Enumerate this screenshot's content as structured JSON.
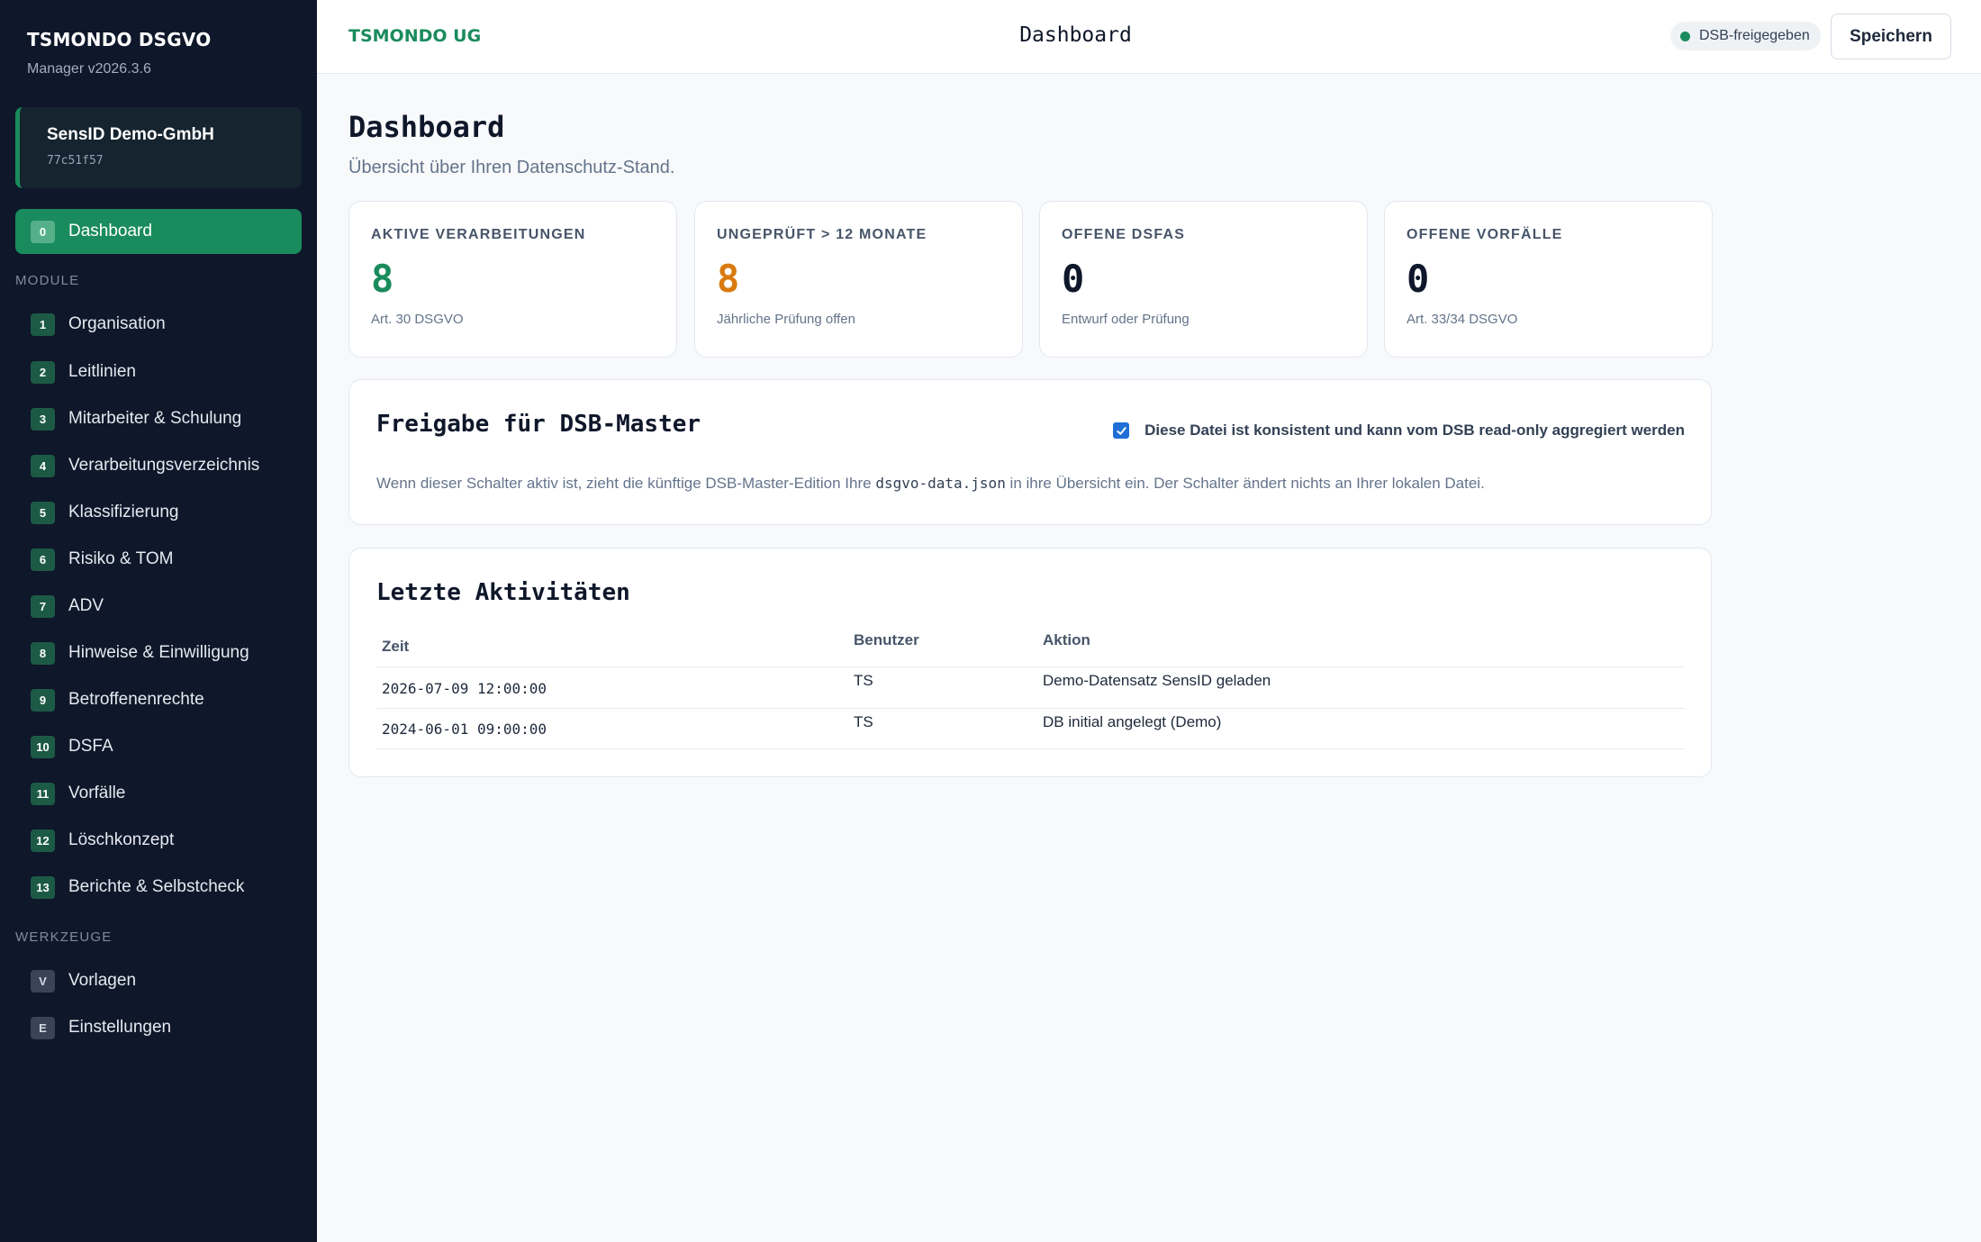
{
  "sidebar": {
    "brand_title": "TSMONDO DSGVO",
    "brand_version": "Manager v2026.3.6",
    "org_name": "SensID Demo-GmbH",
    "org_id": "77c51f57",
    "dashboard": {
      "badge": "0",
      "label": "Dashboard"
    },
    "module_heading": "MODULE",
    "modules": [
      {
        "badge": "1",
        "label": "Organisation"
      },
      {
        "badge": "2",
        "label": "Leitlinien"
      },
      {
        "badge": "3",
        "label": "Mitarbeiter & Schulung"
      },
      {
        "badge": "4",
        "label": "Verarbeitungsverzeichnis"
      },
      {
        "badge": "5",
        "label": "Klassifizierung"
      },
      {
        "badge": "6",
        "label": "Risiko & TOM"
      },
      {
        "badge": "7",
        "label": "ADV"
      },
      {
        "badge": "8",
        "label": "Hinweise & Einwilligung"
      },
      {
        "badge": "9",
        "label": "Betroffenenrechte"
      },
      {
        "badge": "10",
        "label": "DSFA"
      },
      {
        "badge": "11",
        "label": "Vorfälle"
      },
      {
        "badge": "12",
        "label": "Löschkonzept"
      },
      {
        "badge": "13",
        "label": "Berichte & Selbstcheck"
      }
    ],
    "tools_heading": "WERKZEUGE",
    "tools": [
      {
        "badge": "V",
        "label": "Vorlagen"
      },
      {
        "badge": "E",
        "label": "Einstellungen"
      }
    ]
  },
  "topbar": {
    "company": "TSMONDO UG",
    "title": "Dashboard",
    "status": "DSB-freigegeben",
    "save_label": "Speichern"
  },
  "main": {
    "title": "Dashboard",
    "subtitle": "Übersicht über Ihren Datenschutz-Stand.",
    "stats": [
      {
        "label": "AKTIVE VERARBEITUNGEN",
        "value": "8",
        "note": "Art. 30 DSGVO",
        "color": "#1a8b5c"
      },
      {
        "label": "UNGEPRÜFT > 12 MONATE",
        "value": "8",
        "note": "Jährliche Prüfung offen",
        "color": "#d97a0f"
      },
      {
        "label": "OFFENE DSFAS",
        "value": "0",
        "note": "Entwurf oder Prüfung",
        "color": "#0f172a"
      },
      {
        "label": "OFFENE VORFÄLLE",
        "value": "0",
        "note": "Art. 33/34 DSGVO",
        "color": "#0f172a"
      }
    ],
    "release": {
      "title": "Freigabe für DSB-Master",
      "checkbox_label": "Diese Datei ist konsistent und kann vom DSB read-only aggregiert werden",
      "checked": true,
      "desc_before": "Wenn dieser Schalter aktiv ist, zieht die künftige DSB-Master-Edition Ihre ",
      "desc_file": "dsgvo-data.json",
      "desc_after": " in ihre Übersicht ein. Der Schalter ändert nichts an Ihrer lokalen Datei."
    },
    "activity": {
      "title": "Letzte Aktivitäten",
      "headers": {
        "time": "Zeit",
        "user": "Benutzer",
        "action": "Aktion"
      },
      "rows": [
        {
          "time": "2026-07-09 12:00:00",
          "user": "TS",
          "action": "Demo-Datensatz SensID geladen"
        },
        {
          "time": "2024-06-01 09:00:00",
          "user": "TS",
          "action": "DB initial angelegt (Demo)"
        }
      ]
    }
  },
  "colors": {
    "accent": "#1a8b5c",
    "warning": "#d97a0f",
    "sidebar_bg": "#0f172a",
    "checkbox": "#1f6fd6"
  }
}
